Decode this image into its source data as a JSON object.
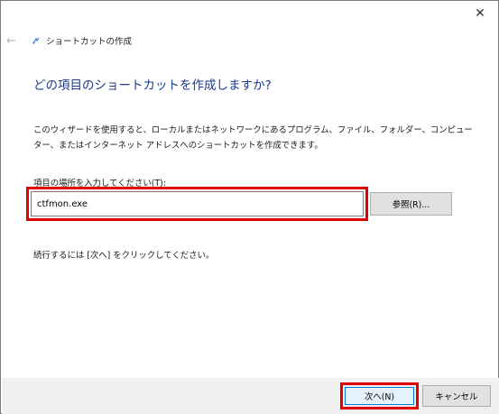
{
  "window": {
    "close_glyph": "✕",
    "back_glyph": "←",
    "title": "ショートカットの作成"
  },
  "main": {
    "heading": "どの項目のショートカットを作成しますか?",
    "description": "このウィザードを使用すると、ローカルまたはネットワークにあるプログラム、ファイル、フォルダー、コンピューター、またはインターネット アドレスへのショートカットを作成できます。",
    "location_label": "項目の場所を入力してください(T):",
    "location_value": "ctfmon.exe",
    "browse_label": "参照(R)...",
    "next_note": "続行するには [次へ] をクリックしてください。"
  },
  "footer": {
    "next_label": "次へ(N)",
    "cancel_label": "キャンセル"
  },
  "colors": {
    "heading": "#1b3b8c",
    "highlight": "#e00000",
    "default_button_border": "#0078d7",
    "footer_bg": "#f0f0f0"
  },
  "icons": {
    "back": "back-arrow-icon",
    "wizard": "shortcut-wizard-icon",
    "close": "close-icon"
  }
}
